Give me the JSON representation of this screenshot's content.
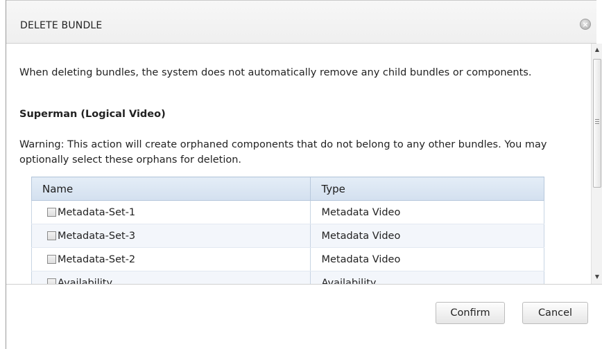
{
  "dialog": {
    "title": "DELETE BUNDLE",
    "close_icon": "close-circle-icon"
  },
  "content": {
    "intro": "When deleting bundles, the system does not automatically remove any child bundles or components.",
    "bundle_name": "Superman (Logical Video)",
    "warning": "Warning: This action will create orphaned components that do not belong to any other bundles. You may optionally select these orphans for deletion."
  },
  "table": {
    "headers": {
      "name": "Name",
      "type": "Type"
    },
    "rows": [
      {
        "name": "Metadata-Set-1",
        "type": "Metadata Video",
        "checked": false
      },
      {
        "name": "Metadata-Set-3",
        "type": "Metadata Video",
        "checked": false
      },
      {
        "name": "Metadata-Set-2",
        "type": "Metadata Video",
        "checked": false
      },
      {
        "name": "Availability",
        "type": "Availability",
        "checked": false
      }
    ]
  },
  "scrollbar": {
    "up_icon": "scroll-up-arrow-icon",
    "down_icon": "scroll-down-arrow-icon"
  },
  "actions": {
    "confirm_label": "Confirm",
    "cancel_label": "Cancel"
  },
  "colors": {
    "header_bg": "#f5f5f5",
    "table_header_bg": "#dbe6f2",
    "table_border": "#b7c8dc",
    "stripe_row": "#f3f6fb"
  }
}
